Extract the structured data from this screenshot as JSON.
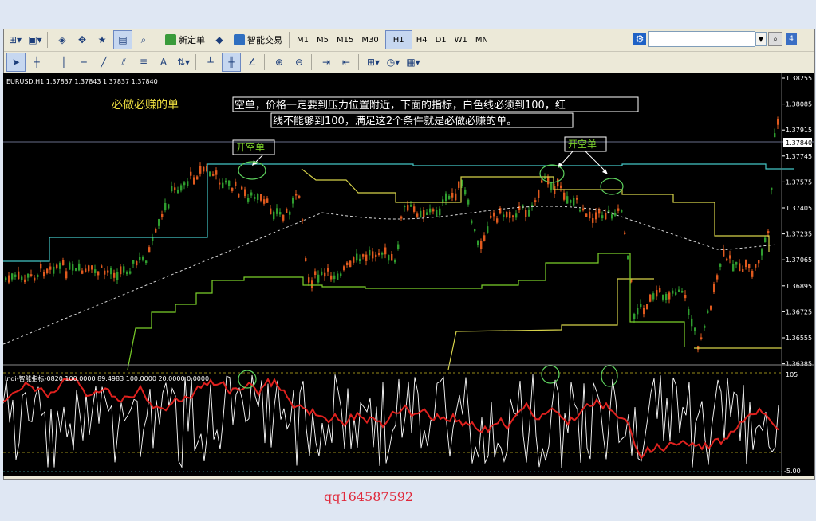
{
  "toolbar": {
    "new_order_label": "新定单",
    "expert_trading_label": "智能交易",
    "periods": [
      "M1",
      "M5",
      "M15",
      "M30",
      "H1",
      "H4",
      "D1",
      "W1",
      "MN"
    ],
    "active_period": "H1",
    "search_placeholder": "",
    "message_count": "4"
  },
  "chart": {
    "symbol_info": "EURUSD,H1  1.37837  1.37843  1.37837  1.37840",
    "current_price": "1.37840",
    "price_scale": [
      "1.38255",
      "1.38085",
      "1.37915",
      "1.37745",
      "1.37575",
      "1.37405",
      "1.37235",
      "1.37065",
      "1.36895",
      "1.36725",
      "1.36555",
      "1.36385"
    ],
    "annotation_title": "必做必赚的单",
    "annotation_line1": "空单，价格一定要到压力位置附近，下面的指标，白色线必须到100，红",
    "annotation_line2": "线不能够到100，满足这2个条件就是必做必赚的单。",
    "label_open_short_1": "开空单",
    "label_open_short_2": "开空单",
    "colors": {
      "up_candle": "#2f9e2f",
      "down_candle": "#e05a1e",
      "cyan_line": "#44c6c6",
      "yellow_line": "#d6d24a",
      "green_line": "#7bd02a",
      "red_osc": "#e0211e"
    }
  },
  "indicator": {
    "header": "Indi-智能指标-0820 100.0000 89.4983 100.0000 20.0000 0.0000",
    "scale_top": "105",
    "scale_bottom": "-5.00"
  },
  "watermark": "qq164587592"
}
